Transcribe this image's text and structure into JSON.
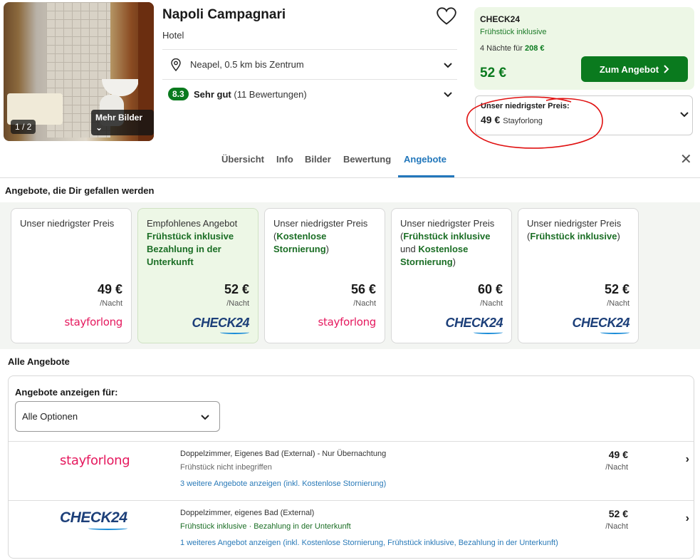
{
  "hotel": {
    "image_counter": "1 / 2",
    "more_images": "Mehr Bilder",
    "name": "Napoli Campagnari",
    "type": "Hotel",
    "location": "Neapel, 0.5 km bis Zentrum",
    "rating_score": "8.3",
    "rating_label": "Sehr gut",
    "rating_count": "(11 Bewertungen)"
  },
  "deal": {
    "provider": "CHECK24",
    "feature": "Frühstück inklusive",
    "nights_prefix": "4 Nächte für",
    "nights_total": "208 €",
    "price": "52 €",
    "button_label": "Zum Angebot"
  },
  "lowest": {
    "label": "Unser niedrigster Preis:",
    "price": "49 €",
    "provider": "Stayforlong"
  },
  "tabs": [
    "Übersicht",
    "Info",
    "Bilder",
    "Bewertung",
    "Angebote"
  ],
  "active_tab": "Angebote",
  "recommended_title": "Angebote, die Dir gefallen werden",
  "cards": [
    {
      "head": "Unser niedrigster Preis",
      "g1": "",
      "mid": "",
      "g2": "",
      "tail": "",
      "price": "49 €",
      "per": "/Nacht",
      "logo": "stayforlong"
    },
    {
      "head": "Empfohlenes Angebot",
      "g1": "Frühstück inklusive Bezahlung in der Unterkunft",
      "mid": "",
      "g2": "",
      "tail": "",
      "price": "52 €",
      "per": "/Nacht",
      "logo": "check24"
    },
    {
      "head": "Unser niedrigster Preis (",
      "g1": "Kostenlose Stornierung",
      "mid": "",
      "g2": "",
      "tail": ")",
      "price": "56 €",
      "per": "/Nacht",
      "logo": "stayforlong"
    },
    {
      "head": "Unser niedrigster Preis (",
      "g1": "Frühstück inklusive",
      "mid": " und ",
      "g2": "Kostenlose Stornierung",
      "tail": ")",
      "price": "60 €",
      "per": "/Nacht",
      "logo": "check24"
    },
    {
      "head": "Unser niedrigster Preis (",
      "g1": "Frühstück inklusive",
      "mid": "",
      "g2": "",
      "tail": ")",
      "price": "52 €",
      "per": "/Nacht",
      "logo": "check24"
    }
  ],
  "logos": {
    "stayforlong": "stayforlong",
    "check24_a": "CHECK",
    "check24_b": "24"
  },
  "all_title": "Alle Angebote",
  "filter": {
    "label": "Angebote anzeigen für:",
    "value": "Alle Optionen"
  },
  "offers": [
    {
      "logo": "stayforlong",
      "room": "Doppelzimmer, Eigenes Bad (External) - Nur Übernachtung",
      "meal": "Frühstück nicht inbegriffen",
      "meal_green": false,
      "more": "3 weitere Angebote anzeigen (inkl. Kostenlose Stornierung)",
      "price": "49 €",
      "per": "/Nacht"
    },
    {
      "logo": "check24",
      "room": "Doppelzimmer, eigenes Bad (External)",
      "meal": "Frühstück inklusive · Bezahlung in der Unterkunft",
      "meal_green": true,
      "more": "1 weiteres Angebot anzeigen (inkl. Kostenlose Stornierung, Frühstück inklusive, Bezahlung in der Unterkunft)",
      "price": "52 €",
      "per": "/Nacht"
    }
  ],
  "colors": {
    "brand_green": "#0a7a1e",
    "deal_bg": "#edf7e6",
    "link_blue": "#2a7ab8",
    "tab_blue": "#2277bb",
    "stayforlong_pink": "#e5195e",
    "check24_navy": "#1c3f79",
    "annotation_red": "#e01010"
  }
}
